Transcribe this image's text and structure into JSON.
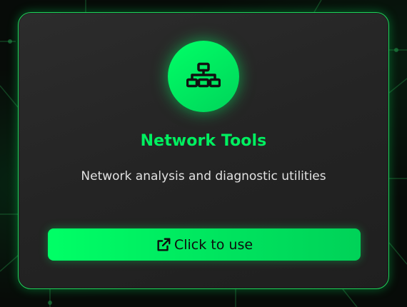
{
  "card": {
    "icon": "network-icon",
    "title": "Network Tools",
    "description": "Network analysis and diagnostic utilities",
    "button_label": "Click to use",
    "button_icon": "external-link-icon"
  },
  "colors": {
    "accent": "#00ff66",
    "card_bg": "#262626",
    "title": "#00f060",
    "description": "#e2e2e2",
    "button_text": "#0d0d0d"
  }
}
